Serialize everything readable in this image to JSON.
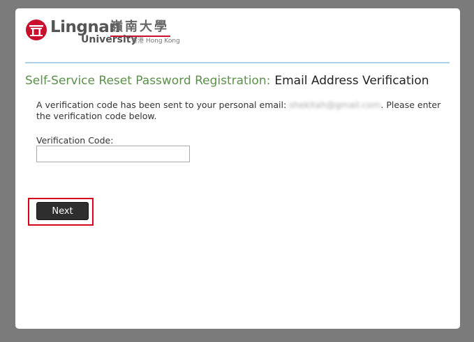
{
  "logo": {
    "name_en": "Lingnan",
    "name_zh": "嶺南大學",
    "sub_en": "University",
    "sub_location": "香港 Hong Kong"
  },
  "header": {
    "title_left": "Self-Service Reset Password Registration:",
    "title_right": "Email Address Verification"
  },
  "message": {
    "prefix": "A verification code has been sent to your personal email:",
    "email": "shekitah@gmail.com",
    "suffix": ". Please enter the verification code below."
  },
  "form": {
    "code_label": "Verification Code:",
    "code_value": "",
    "next_label": "Next"
  },
  "colors": {
    "title_green": "#5b8f4a",
    "divider": "#a9d1e8",
    "highlight_red": "#d9001b",
    "button_dark": "#2e2e2e",
    "brand_red": "#c8102e"
  }
}
